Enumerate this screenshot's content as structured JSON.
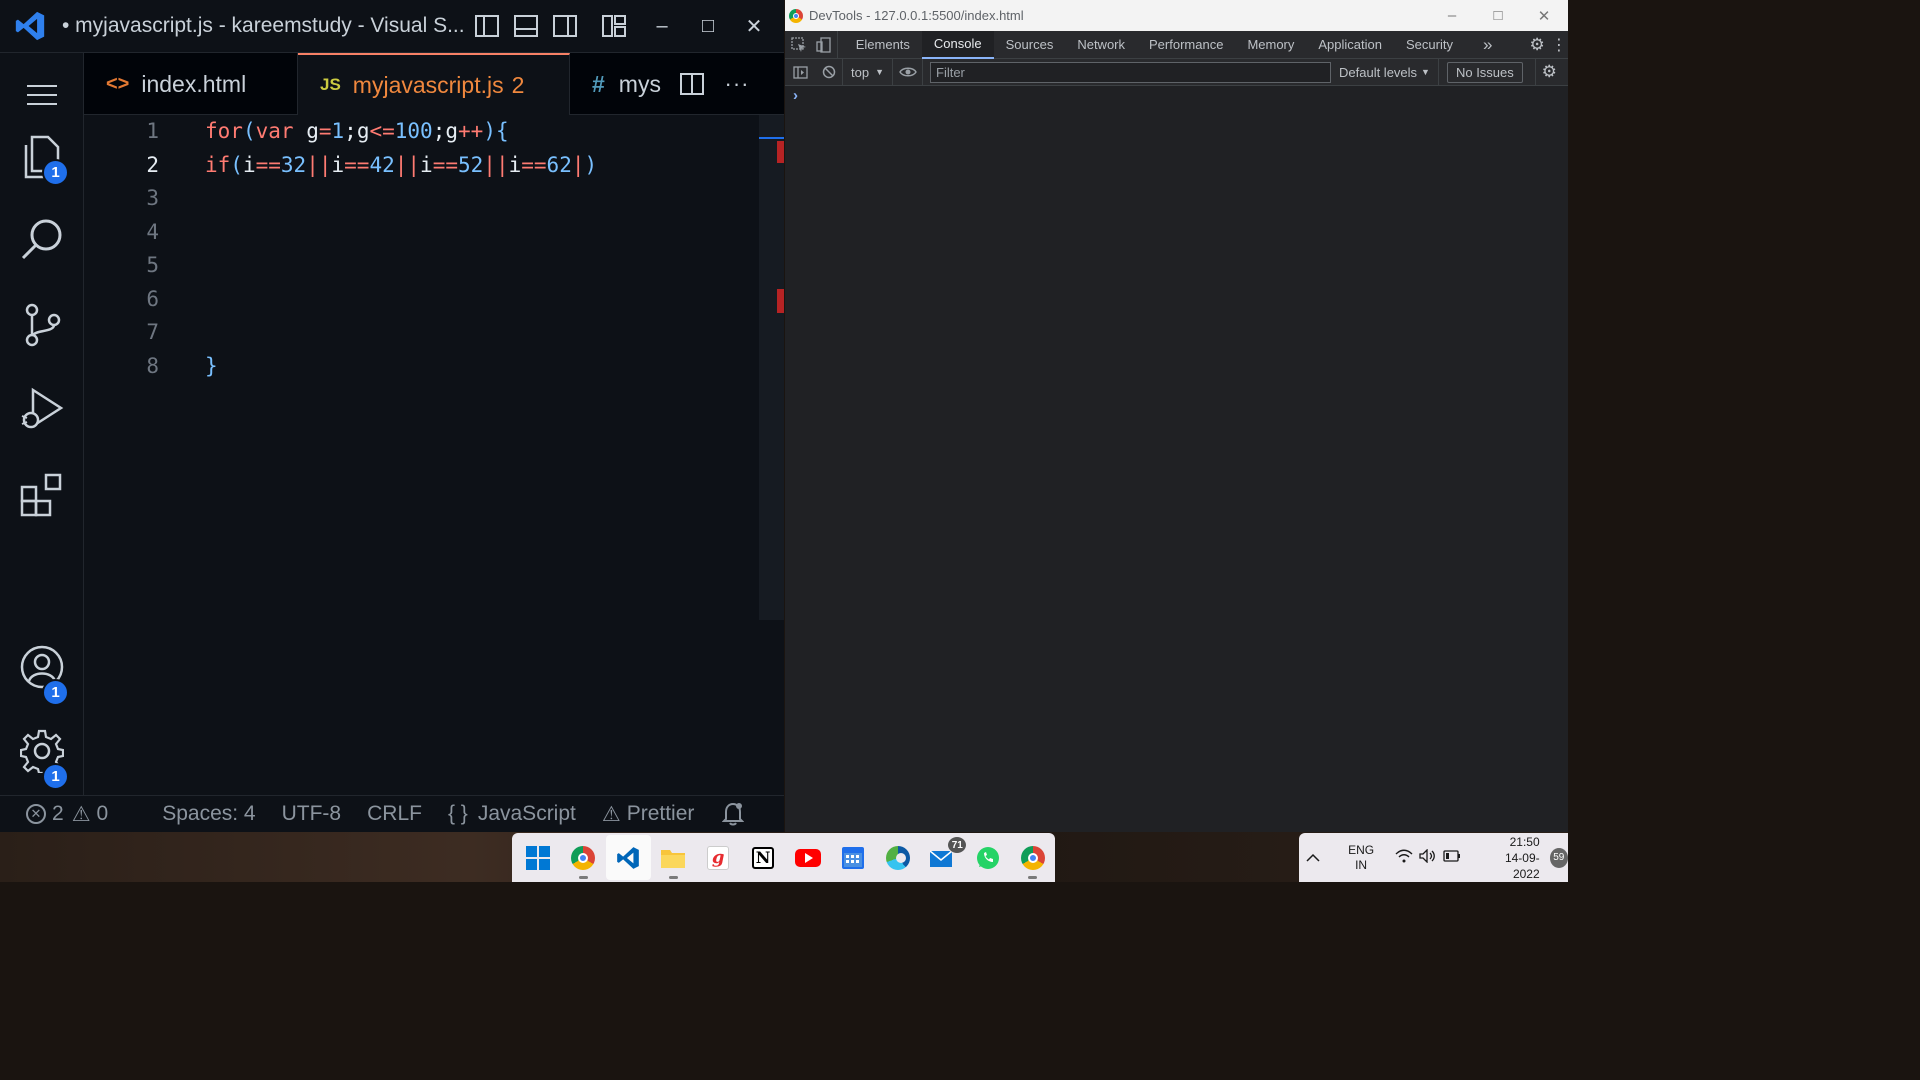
{
  "vscode": {
    "title": "• myjavascript.js - kareemstudy - Visual S...",
    "tabs": [
      {
        "icon": "<>",
        "label": "index.html"
      },
      {
        "icon": "JS",
        "label": "myjavascript.js",
        "problems": "2"
      },
      {
        "icon": "#",
        "label": "mys"
      }
    ],
    "badges": {
      "explorer": "1",
      "accounts": "1",
      "settings": "1"
    },
    "lines": [
      "1",
      "2",
      "3",
      "4",
      "5",
      "6",
      "7",
      "8"
    ],
    "code": {
      "line1": "for(var g=1;g<=100;g++){",
      "line2": "if(i==32||i==42||i==52||i==62|)",
      "line8": "}"
    },
    "status": {
      "errors": "2",
      "warnings": "0",
      "spaces": "Spaces: 4",
      "encoding": "UTF-8",
      "eol": "CRLF",
      "lang_icon": "{ }",
      "language": "JavaScript",
      "prettier": "Prettier"
    }
  },
  "devtools": {
    "title": "DevTools - 127.0.0.1:5500/index.html",
    "tabs": [
      "Elements",
      "Console",
      "Sources",
      "Network",
      "Performance",
      "Memory",
      "Application",
      "Security"
    ],
    "more": "»",
    "context": "top",
    "filter_placeholder": "Filter",
    "levels": "Default levels",
    "issues": "No Issues",
    "prompt": "›"
  },
  "taskbar": {
    "mail_badge": "71",
    "lang_top": "ENG",
    "lang_bottom": "IN",
    "time": "21:50",
    "date": "14-09-2022",
    "notifications": "59"
  }
}
